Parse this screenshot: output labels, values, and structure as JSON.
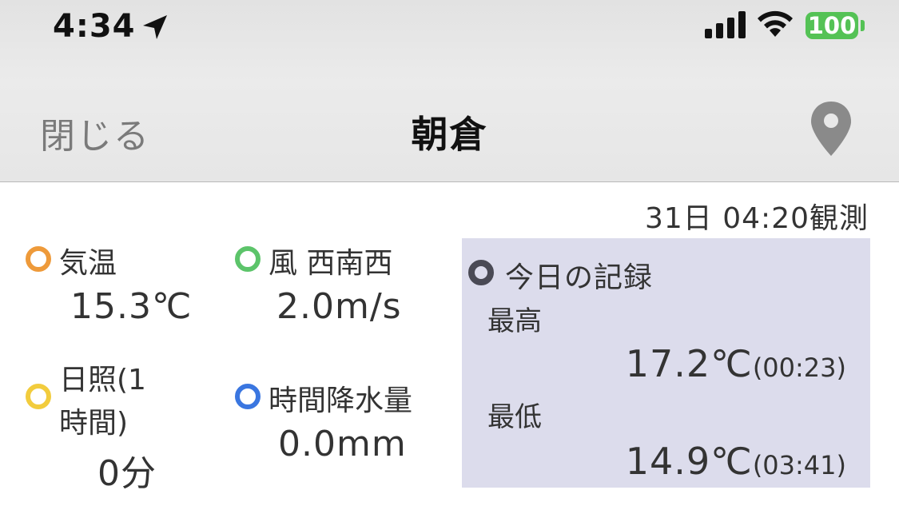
{
  "status_bar": {
    "time": "4:34",
    "battery": "100",
    "colors": {
      "battery": "#54c255"
    }
  },
  "nav": {
    "close_label": "閉じる",
    "title": "朝倉",
    "right_icon": "map-pin-icon"
  },
  "observation_time": "31日 04:20観測",
  "metrics": {
    "temperature": {
      "label": "気温",
      "value": "15.3℃",
      "dot_color": "#ee9a3a"
    },
    "wind": {
      "label": "風 西南西",
      "value": "2.0m/s",
      "dot_color": "#5cc46a"
    },
    "sunshine": {
      "label_line1": "日照(1",
      "label_line2": "時間)",
      "value": "0分",
      "dot_color": "#f2cc3d"
    },
    "precipitation": {
      "label": "時間降水量",
      "value": "0.0mm",
      "dot_color": "#3a76e0"
    }
  },
  "today_record": {
    "title": "今日の記録",
    "high": {
      "label": "最高",
      "value": "17.2℃",
      "time": "(00:23)"
    },
    "low": {
      "label": "最低",
      "value": "14.9℃",
      "time": "(03:41)"
    },
    "panel_color": "#dcdcec"
  }
}
